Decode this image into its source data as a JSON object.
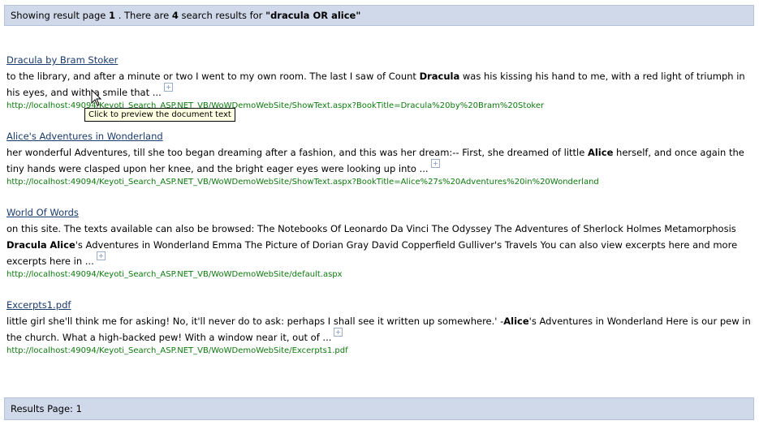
{
  "header": {
    "prefix": "Showing result page ",
    "page": "1",
    "middle": " . There are ",
    "count": "4",
    "suffix": " search results for ",
    "query": "\"dracula OR alice\""
  },
  "results": [
    {
      "title": "Dracula by Bram Stoker",
      "snippet": [
        {
          "t": "to the library, and after a minute or two I went to my own room. The last I saw of Count "
        },
        {
          "t": "Dracula",
          "b": true
        },
        {
          "t": " was his kissing his hand to me, with a red light of triumph in his eyes, and with a smile that ..."
        }
      ],
      "url": "http://localhost:49094/Keyoti_Search_ASP.NET_VB/WoWDemoWebSite/ShowText.aspx?BookTitle=Dracula%20by%20Bram%20Stoker"
    },
    {
      "title": "Alice's Adventures in Wonderland",
      "snippet": [
        {
          "t": "her wonderful Adventures, till she too began dreaming after a fashion, and this was her dream:-- First, she dreamed of little "
        },
        {
          "t": "Alice",
          "b": true
        },
        {
          "t": " herself, and once again the tiny hands were clasped upon her knee, and the bright eager eyes were looking up into ..."
        }
      ],
      "url": "http://localhost:49094/Keyoti_Search_ASP.NET_VB/WoWDemoWebSite/ShowText.aspx?BookTitle=Alice%27s%20Adventures%20in%20Wonderland"
    },
    {
      "title": "World Of Words",
      "snippet": [
        {
          "t": "on this site. The texts available can also be browsed: The Notebooks Of Leonardo Da Vinci The Odyssey The Adventures of Sherlock Holmes Metamorphosis "
        },
        {
          "t": "Dracula",
          "b": true
        },
        {
          "t": " "
        },
        {
          "t": "Alice",
          "b": true
        },
        {
          "t": "'s Adventures in Wonderland Emma The Picture of Dorian Gray David Copperfield Gulliver's Travels You can also view excerpts here and more excerpts here in ..."
        }
      ],
      "url": "http://localhost:49094/Keyoti_Search_ASP.NET_VB/WoWDemoWebSite/default.aspx"
    },
    {
      "title": "Excerpts1.pdf",
      "snippet": [
        {
          "t": "little girl she'll think me for asking! No, it'll never do to ask: perhaps I shall see it written up somewhere.' -"
        },
        {
          "t": "Alice",
          "b": true
        },
        {
          "t": "'s Adventures in Wonderland Here is our pew in the church. What a high-backed pew! With a window near it, out of ..."
        }
      ],
      "url": "http://localhost:49094/Keyoti_Search_ASP.NET_VB/WoWDemoWebSite/Excerpts1.pdf"
    }
  ],
  "tooltip": "Click to preview the document text",
  "footer": {
    "label": "Results Page: ",
    "page": "1"
  },
  "icons": {
    "expand": "plus-box-icon",
    "cursor": "arrow-cursor-icon"
  },
  "colors": {
    "bar_background": "#d0d9ea",
    "link": "#1a3b6e",
    "url": "#0c7a0c"
  }
}
